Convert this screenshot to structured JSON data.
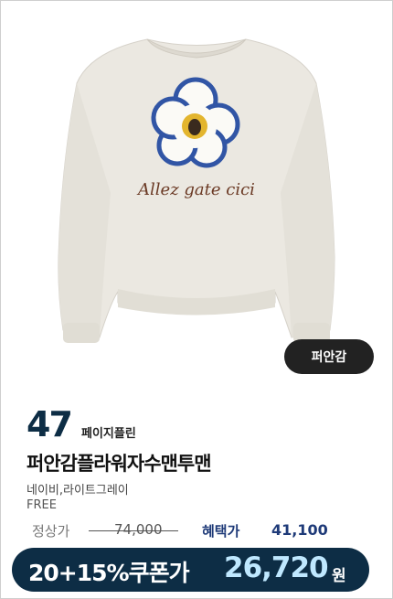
{
  "product": {
    "brand_tag": "퍼안감",
    "rank": "47",
    "brand": "페이지플린",
    "title": "퍼안감플라워자수맨투맨",
    "colors": "네이비,라이트그레이",
    "size": "FREE",
    "embroidery_text": "Allez gate cici"
  },
  "pricing": {
    "normal_label": "정상가",
    "normal_price": "74,000",
    "benefit_label": "혜택가",
    "benefit_price": "41,100",
    "coupon_label": "20+15%쿠폰가",
    "coupon_price": "26,720",
    "coupon_unit": "원"
  },
  "colors": {
    "navy": "#0d2d45",
    "benefit": "#1e3a78",
    "coupon_price": "#bfe8ff"
  }
}
